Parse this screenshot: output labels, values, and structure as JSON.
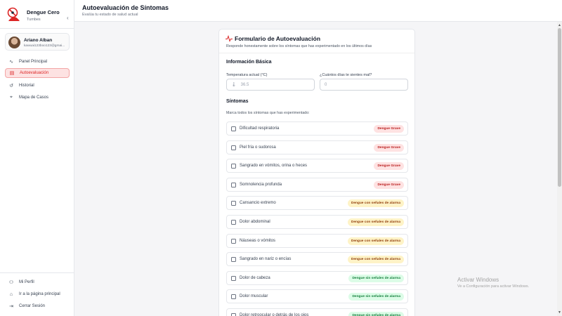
{
  "brand": {
    "name": "Dengue Cero",
    "location": "Tumbes",
    "collapse_icon": "chevron-left-icon"
  },
  "user": {
    "name": "Ariano Alban",
    "email": "kawuai123boo123@gmai..."
  },
  "nav": {
    "items": [
      {
        "label": "Panel Principal",
        "icon": "activity-icon",
        "glyph": "∿",
        "active": false
      },
      {
        "label": "Autoevaluación",
        "icon": "clipboard-icon",
        "glyph": "▤",
        "active": true
      },
      {
        "label": "Historial",
        "icon": "history-icon",
        "glyph": "↺",
        "active": false
      },
      {
        "label": "Mapa de Casos",
        "icon": "map-pin-icon",
        "glyph": "⌖",
        "active": false
      }
    ],
    "bottom": [
      {
        "label": "Mi Perfil",
        "icon": "user-icon",
        "glyph": "⚇"
      },
      {
        "label": "Ir a la página principal",
        "icon": "home-icon",
        "glyph": "⌂"
      },
      {
        "label": "Cerrar Sesión",
        "icon": "logout-icon",
        "glyph": "⇥"
      }
    ]
  },
  "header": {
    "title": "Autoevaluación de Síntomas",
    "subtitle": "Evalúa tu estado de salud actual"
  },
  "form": {
    "title": "Formulario de Autoevaluación",
    "description": "Responde honestamente sobre los síntomas que has experimentado en los últimos días",
    "basic_title": "Información Básica",
    "temp_label": "Temperatura actual (°C)",
    "temp_placeholder": "36.5",
    "days_label": "¿Cuántos días te sientes mal?",
    "days_placeholder": "0",
    "symptoms_title": "Síntomas",
    "symptoms_hint": "Marca todos los síntomas que has experimentado:",
    "symptoms": [
      {
        "label": "Dificultad respiratoria",
        "badge": "Dengue Grave",
        "level": "grave"
      },
      {
        "label": "Piel fría o sudorosa",
        "badge": "Dengue Grave",
        "level": "grave"
      },
      {
        "label": "Sangrado en vómitos, orina o heces",
        "badge": "Dengue Grave",
        "level": "grave"
      },
      {
        "label": "Somnolencia profunda",
        "badge": "Dengue Grave",
        "level": "grave"
      },
      {
        "label": "Cansancio extremo",
        "badge": "Dengue con señales de alarma",
        "level": "alarma"
      },
      {
        "label": "Dolor abdominal",
        "badge": "Dengue con señales de alarma",
        "level": "alarma"
      },
      {
        "label": "Náuseas o vómitos",
        "badge": "Dengue con señales de alarma",
        "level": "alarma"
      },
      {
        "label": "Sangrado en nariz o encías",
        "badge": "Dengue con señales de alarma",
        "level": "alarma"
      },
      {
        "label": "Dolor de cabeza",
        "badge": "Dengue sin señales de alarma",
        "level": "sin"
      },
      {
        "label": "Dolor muscular",
        "badge": "Dengue sin señales de alarma",
        "level": "sin"
      },
      {
        "label": "Dolor retroocular o detrás de los ojos",
        "badge": "Dengue sin señales de alarma",
        "level": "sin"
      }
    ]
  },
  "badge_colors": {
    "grave": {
      "bg": "#fee2e2",
      "fg": "#b91c1c"
    },
    "alarma": {
      "bg": "#fef3c7",
      "fg": "#92400e"
    },
    "sin": {
      "bg": "#dcfce7",
      "fg": "#15803d"
    }
  },
  "accent": "#dc2626",
  "watermark": {
    "title": "Activar Windows",
    "subtitle": "Ve a Configuración para activar Windows."
  }
}
